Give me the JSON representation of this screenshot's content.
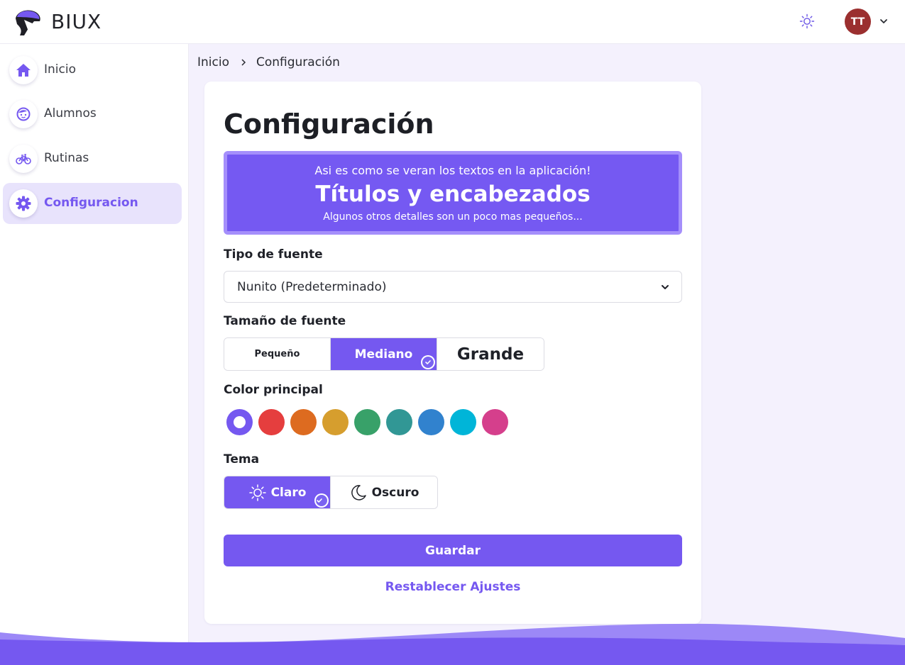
{
  "app": {
    "brand": "BIUX"
  },
  "header": {
    "avatar_initials": "TT",
    "theme_icon": "sun-icon",
    "menu_icon": "chevron-down-icon"
  },
  "sidebar": {
    "items": [
      {
        "label": "Inicio",
        "icon": "home-icon",
        "active": false
      },
      {
        "label": "Alumnos",
        "icon": "child-face-icon",
        "active": false
      },
      {
        "label": "Rutinas",
        "icon": "bicycle-icon",
        "active": false
      },
      {
        "label": "Configuracion",
        "icon": "gear-icon",
        "active": true
      }
    ]
  },
  "breadcrumb": {
    "home": "Inicio",
    "current": "Configuración"
  },
  "page": {
    "title": "Configuración"
  },
  "preview": {
    "line1": "Asi es como se veran los textos en la aplicación!",
    "line2": "Títulos y encabezados",
    "line3": "Algunos otros detalles son un poco mas pequeños..."
  },
  "font_type": {
    "label": "Tipo de fuente",
    "selected": "Nunito (Predeterminado)"
  },
  "font_size": {
    "label": "Tamaño de fuente",
    "options": [
      "Pequeño",
      "Mediano",
      "Grande"
    ],
    "selected": "Mediano"
  },
  "primary_color": {
    "label": "Color principal",
    "options": [
      "#7558f0",
      "#e53e3e",
      "#dd6b20",
      "#d69e2e",
      "#38a169",
      "#319795",
      "#3182ce",
      "#00b5d8",
      "#d53f8c"
    ],
    "selected": "#7558f0"
  },
  "theme": {
    "label": "Tema",
    "options": [
      "Claro",
      "Oscuro"
    ],
    "selected": "Claro"
  },
  "actions": {
    "save": "Guardar",
    "reset": "Restablecer Ajustes"
  },
  "colors": {
    "accent": "#7558f0",
    "accent_light": "#e8e3fc",
    "background": "#f4f1fd",
    "avatar": "#9b2f2f"
  }
}
